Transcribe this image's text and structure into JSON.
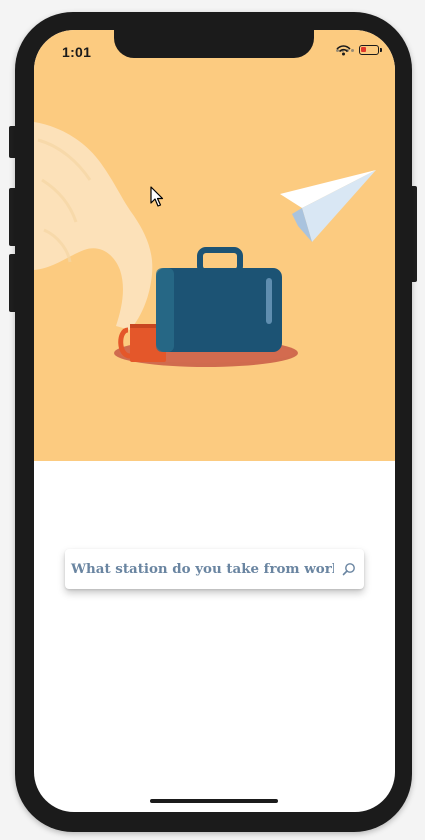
{
  "status_bar": {
    "time": "1:01",
    "icons": [
      "signal-dots-icon",
      "wifi-icon",
      "battery-icon"
    ]
  },
  "hero": {
    "background_color": "#fccb80",
    "illustration": [
      "steam-cloud",
      "coffee-mug-icon",
      "briefcase-icon",
      "paper-plane-icon"
    ]
  },
  "search": {
    "placeholder": "What station do you take from work?",
    "icon": "search-icon",
    "text_color": "#6a85a1"
  },
  "colors": {
    "briefcase": "#1c5374",
    "mug": "#e4572a",
    "plane": "#ffffff"
  }
}
